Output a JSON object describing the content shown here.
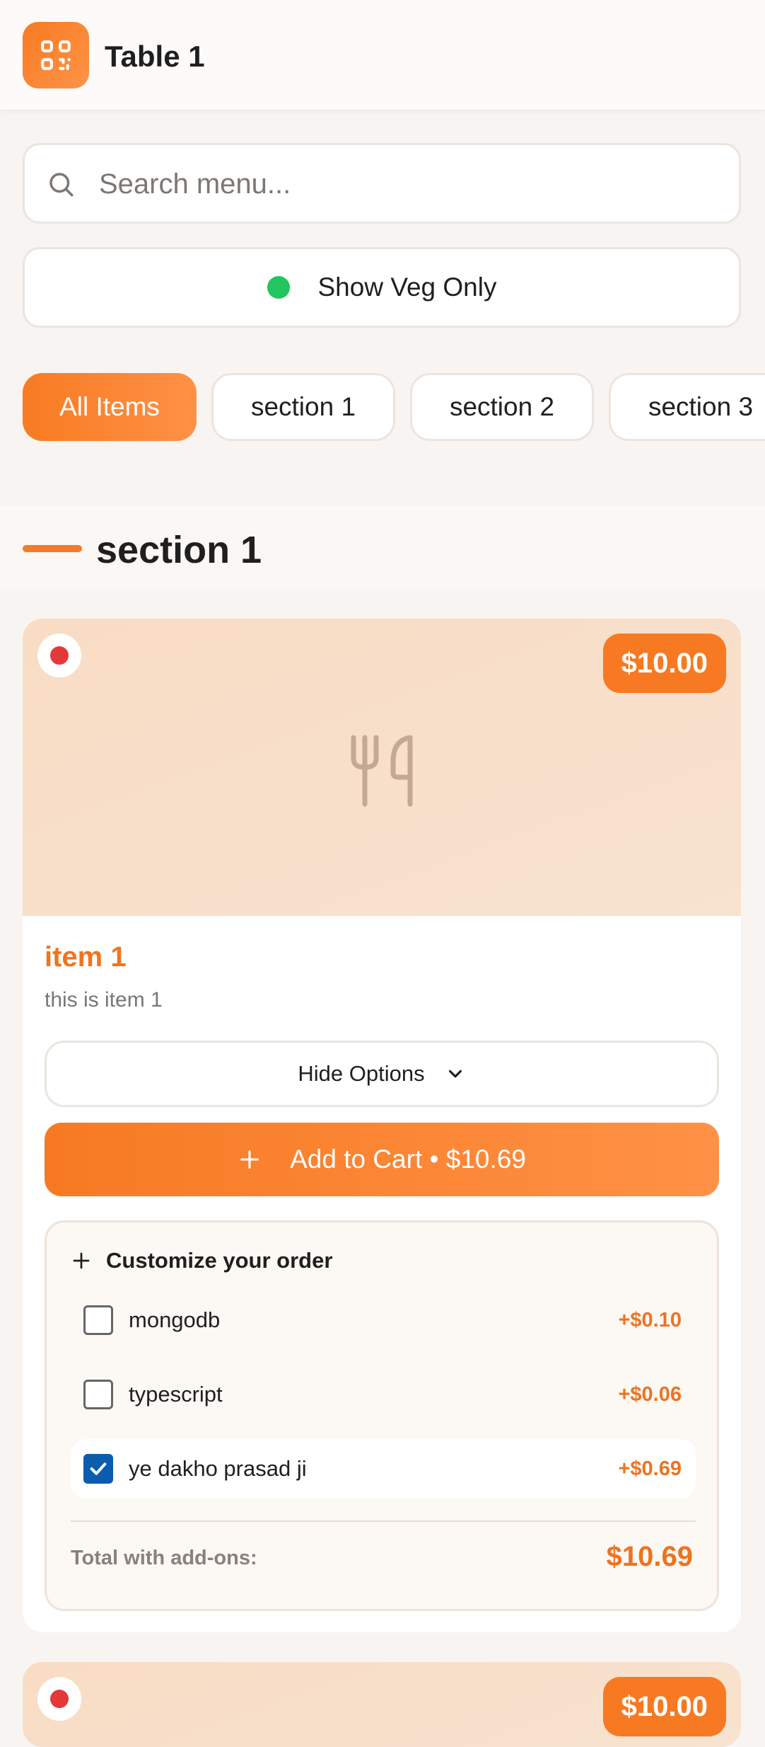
{
  "header": {
    "title": "Table 1",
    "logo_icon": "qr-code-icon"
  },
  "search": {
    "placeholder": "Search menu...",
    "value": ""
  },
  "veg_filter": {
    "label": "Show Veg Only",
    "dot_color": "#22c55e"
  },
  "tabs": [
    {
      "label": "All Items",
      "active": true
    },
    {
      "label": "section 1",
      "active": false
    },
    {
      "label": "section 2",
      "active": false
    },
    {
      "label": "section 3",
      "active": false
    }
  ],
  "section": {
    "title": "section 1"
  },
  "items": [
    {
      "name": "item 1",
      "description": "this is item 1",
      "price": "$10.00",
      "type": "non-veg",
      "type_color": "#e5383b",
      "image_icon": "utensils-icon",
      "hide_options_label": "Hide Options",
      "add_to_cart_label": "Add to Cart • $10.69",
      "customize": {
        "title": "Customize your order",
        "options": [
          {
            "name": "mongodb",
            "price": "+$0.10",
            "checked": false
          },
          {
            "name": "typescript",
            "price": "+$0.06",
            "checked": false
          },
          {
            "name": "ye dakho prasad ji",
            "price": "+$0.69",
            "checked": true
          }
        ],
        "total_label": "Total with add-ons:",
        "total_value": "$10.69"
      }
    },
    {
      "price": "$10.00",
      "type": "non-veg"
    }
  ],
  "colors": {
    "accent": "#f77a22",
    "background": "#f8f4f1",
    "checkbox_checked": "#0b5cad"
  }
}
